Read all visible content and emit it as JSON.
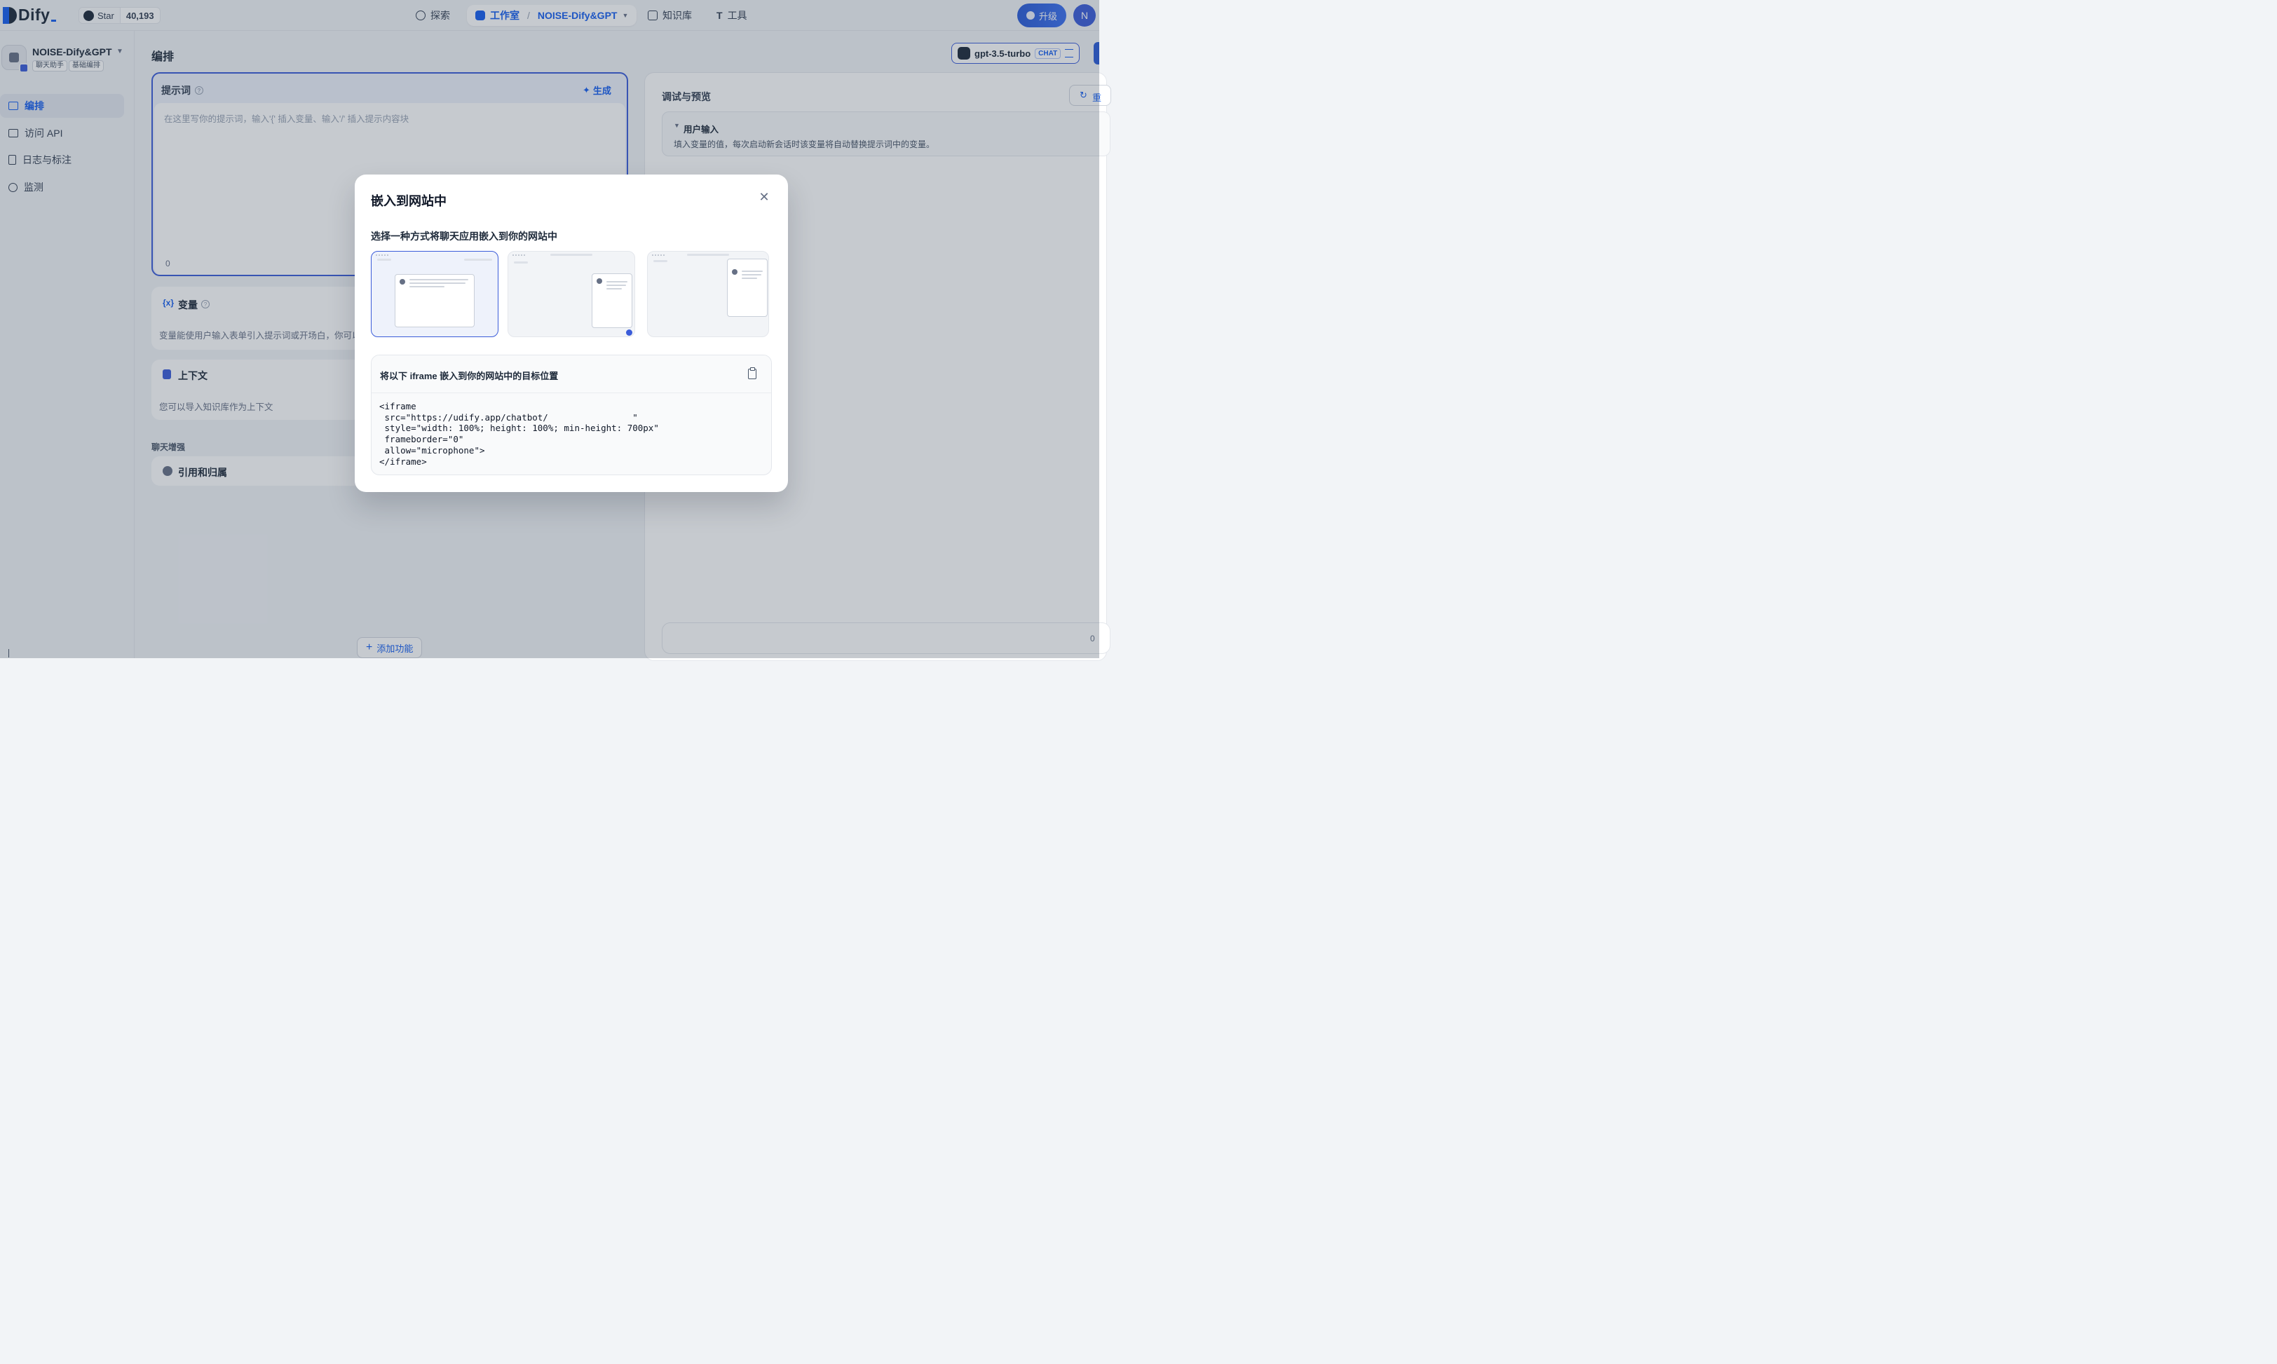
{
  "header": {
    "logo_text": "Dify",
    "github_label": "Star",
    "github_count": "40,193",
    "nav": {
      "explore": "探索",
      "studio": "工作室",
      "studio_app": "NOISE-Dify&GPT",
      "knowledge": "知识库",
      "tools": "工具"
    },
    "upgrade_label": "升级",
    "avatar_initial": "N"
  },
  "sidebar": {
    "app_name": "NOISE-Dify&GPT",
    "tags": [
      "聊天助手",
      "基础编排"
    ],
    "items": [
      {
        "label": "编排",
        "icon": "layout-icon",
        "active": true
      },
      {
        "label": "访问 API",
        "icon": "terminal-icon",
        "active": false
      },
      {
        "label": "日志与标注",
        "icon": "file-list-icon",
        "active": false
      },
      {
        "label": "监测",
        "icon": "dashboard-icon",
        "active": false
      }
    ]
  },
  "main": {
    "title": "编排",
    "model": {
      "name": "gpt-3.5-turbo",
      "mode": "CHAT"
    },
    "prompt": {
      "label": "提示词",
      "generate_label": "生成",
      "placeholder": "在这里写你的提示词，输入'{' 插入变量、输入'/' 插入提示内容块",
      "count": "0"
    },
    "variables": {
      "title": "变量",
      "desc": "变量能使用户输入表单引入提示词或开场白，你可以试"
    },
    "context": {
      "title": "上下文",
      "desc": "您可以导入知识库作为上下文"
    },
    "chat_enhance_label": "聊天增强",
    "citation_title": "引用和归属",
    "add_feature_label": "添加功能"
  },
  "debug": {
    "title": "调试与预览",
    "restart_label": "重",
    "user_input_title": "用户输入",
    "user_input_desc": "填入变量的值，每次启动新会话时该变量将自动替换提示词中的变量。",
    "chat_count": "0"
  },
  "modal": {
    "title": "嵌入到网站中",
    "subtitle": "选择一种方式将聊天应用嵌入到你的网站中",
    "options": [
      "iframe",
      "script-bubble",
      "chrome-extension"
    ],
    "selected_option": "iframe",
    "code_label": "将以下 iframe 嵌入到你的网站中的目标位置",
    "code": "<iframe\n src=\"https://udify.app/chatbot/                \"\n style=\"width: 100%; height: 100%; min-height: 700px\"\n frameborder=\"0\"\n allow=\"microphone\">\n</iframe>"
  },
  "colors": {
    "accent": "#155eef",
    "background": "#f2f4f7"
  }
}
